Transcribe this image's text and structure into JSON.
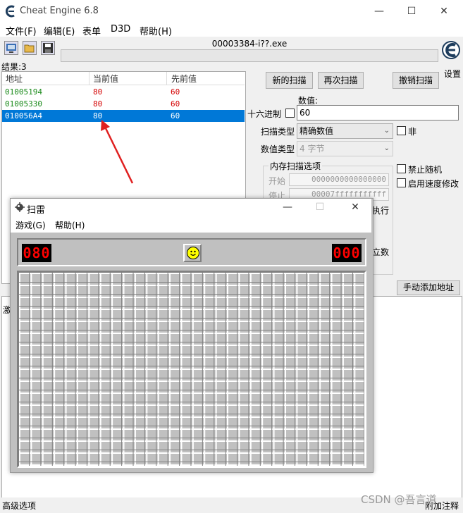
{
  "ce": {
    "window_title": "Cheat Engine 6.8",
    "menu": [
      "文件(F)",
      "编辑(E)",
      "表单",
      "D3D",
      "帮助(H)"
    ],
    "process_title": "00003384-i??.exe",
    "settings_label": "设置",
    "results_count": "结果:3",
    "columns": [
      "地址",
      "当前值",
      "先前值"
    ],
    "rows": [
      {
        "address": "01005194",
        "current": "80",
        "previous": "60",
        "selected": false
      },
      {
        "address": "01005330",
        "current": "80",
        "previous": "60",
        "selected": false
      },
      {
        "address": "010056A4",
        "current": "80",
        "previous": "60",
        "selected": true
      }
    ],
    "buttons": {
      "new_scan": "新的扫描",
      "next_scan": "再次扫描",
      "undo_scan": "撤销扫描",
      "add_address": "手动添加地址"
    },
    "value_label": "数值:",
    "hex_label": "十六进制",
    "value_input": "60",
    "scan_type_label": "扫描类型",
    "scan_type_value": "精确数值",
    "not_label": "非",
    "value_type_label": "数值类型",
    "value_type_value": "4 字节",
    "mem_options_label": "内存扫描选项",
    "start_label": "开始",
    "start_value": "0000000000000000",
    "stop_label": "停止",
    "stop_value": "00007fffffffffff",
    "exec_label": "执行",
    "align_label": "立数",
    "disable_random": "禁止随机",
    "speedhack": "启用速度修改",
    "activate_partial": "激",
    "advanced_options": "高级选项",
    "add_comment": "附加注释",
    "colors": {
      "selected_row": "#0078d7",
      "address_green": "#1a8a1a",
      "value_red": "#d40000"
    }
  },
  "minesweeper": {
    "window_title": "扫雷",
    "menu": [
      "游戏(G)",
      "帮助(H)"
    ],
    "mine_counter": "080",
    "timer": "000",
    "face": "smiley-icon"
  },
  "watermark": "CSDN @吾言道"
}
